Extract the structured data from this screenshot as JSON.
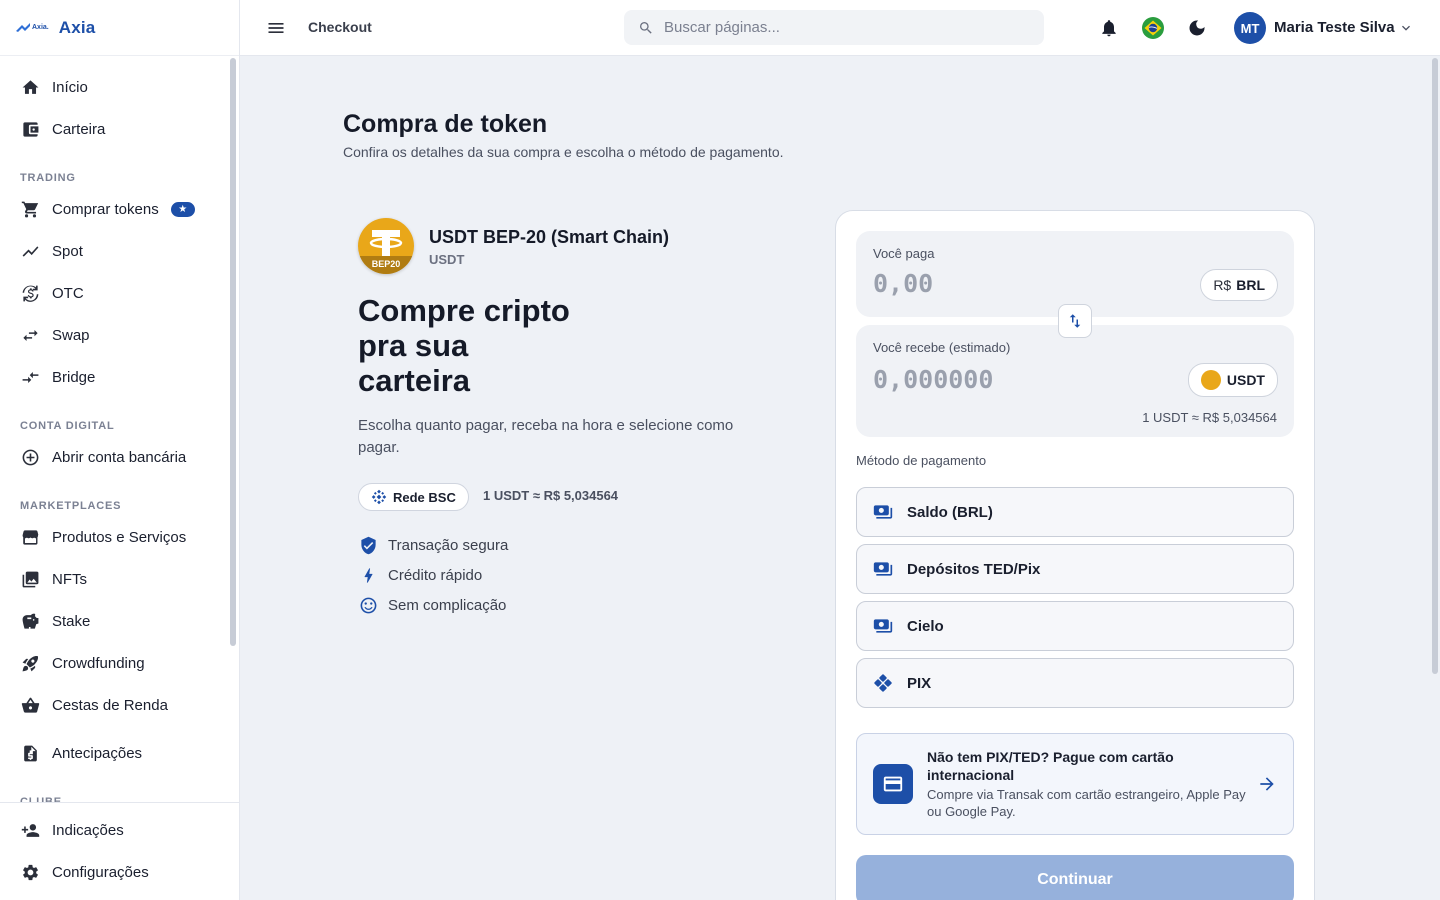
{
  "brand": {
    "mini": "Axia.",
    "name": "Axia"
  },
  "sidebar": {
    "items_top": [
      {
        "label": "Início",
        "icon": "home-icon"
      },
      {
        "label": "Carteira",
        "icon": "wallet-icon"
      }
    ],
    "sections": [
      {
        "title": "TRADING",
        "items": [
          {
            "label": "Comprar tokens",
            "icon": "cart-icon",
            "badge": "★"
          },
          {
            "label": "Spot",
            "icon": "trend-icon"
          },
          {
            "label": "OTC",
            "icon": "otc-icon"
          },
          {
            "label": "Swap",
            "icon": "swap-icon"
          },
          {
            "label": "Bridge",
            "icon": "bridge-icon"
          }
        ]
      },
      {
        "title": "CONTA DIGITAL",
        "items": [
          {
            "label": "Abrir conta bancária",
            "icon": "add-circle-icon"
          }
        ]
      },
      {
        "title": "MARKETPLACES",
        "items": [
          {
            "label": "Produtos e Serviços",
            "icon": "store-icon"
          },
          {
            "label": "NFTs",
            "icon": "image-icon"
          },
          {
            "label": "Stake",
            "icon": "piggy-icon"
          },
          {
            "label": "Crowdfunding",
            "icon": "rocket-icon"
          },
          {
            "label": "Cestas de Renda",
            "icon": "basket-icon"
          },
          {
            "label": "Antecipações",
            "icon": "receipt-icon"
          }
        ]
      },
      {
        "title": "CLUBE",
        "items": []
      }
    ],
    "bottom": [
      {
        "label": "Indicações",
        "icon": "add-person-icon"
      },
      {
        "label": "Configurações",
        "icon": "settings-icon"
      }
    ]
  },
  "header": {
    "crumb": "Checkout",
    "search_placeholder": "Buscar páginas...",
    "user_initials": "MT",
    "user_name": "Maria Teste Silva"
  },
  "page": {
    "title": "Compra de token",
    "subtitle": "Confira os detalhes da sua compra e escolha o método de pagamento."
  },
  "token": {
    "name": "USDT BEP-20 (Smart Chain)",
    "symbol": "USDT",
    "logo_badge": "BEP20",
    "hero_lines": [
      "Compre cripto",
      "pra sua",
      "carteira"
    ],
    "hero_sub": "Escolha quanto pagar, receba na hora e selecione como pagar.",
    "network": "Rede BSC",
    "rate": "1 USDT ≈ R$ 5,034564",
    "features": [
      "Transação segura",
      "Crédito rápido",
      "Sem complicação"
    ]
  },
  "card": {
    "pay_label": "Você paga",
    "pay_amount": "0,00",
    "pay_currency_prefix": "R$",
    "pay_currency": "BRL",
    "receive_label": "Você recebe (estimado)",
    "receive_amount": "0,000000",
    "receive_currency": "USDT",
    "rate": "1 USDT ≈ R$ 5,034564",
    "payment_label": "Método de pagamento",
    "methods": [
      "Saldo (BRL)",
      "Depósitos TED/Pix",
      "Cielo",
      "PIX"
    ],
    "intl_title": "Não tem PIX/TED? Pague com cartão internacional",
    "intl_desc": "Compre via Transak com cartão estrangeiro, Apple Pay ou Google Pay.",
    "continue_label": "Continuar"
  },
  "colors": {
    "accent": "#1d4fa8",
    "continue_disabled": "#96b1dc"
  }
}
